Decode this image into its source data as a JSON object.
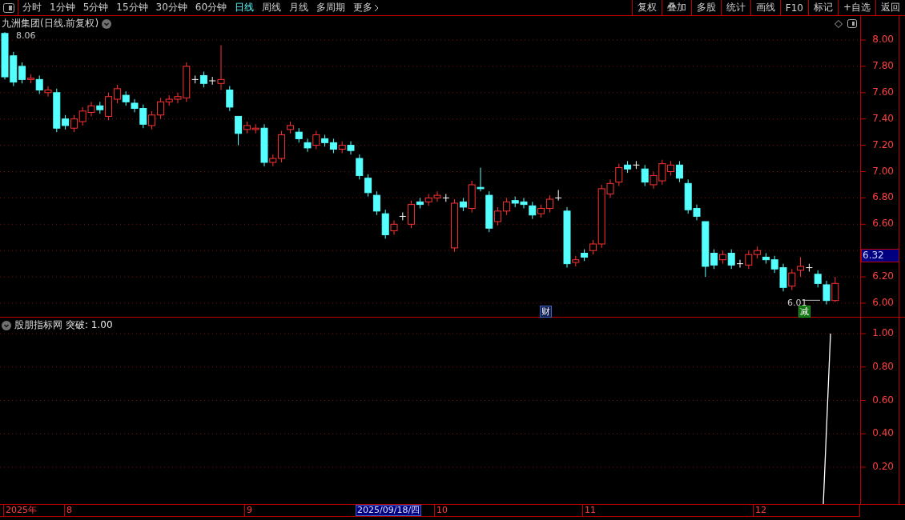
{
  "toolbar": {
    "periods": [
      {
        "label": "分时",
        "selected": false
      },
      {
        "label": "1分钟",
        "selected": false
      },
      {
        "label": "5分钟",
        "selected": false
      },
      {
        "label": "15分钟",
        "selected": false
      },
      {
        "label": "30分钟",
        "selected": false
      },
      {
        "label": "60分钟",
        "selected": false
      },
      {
        "label": "日线",
        "selected": true
      },
      {
        "label": "周线",
        "selected": false
      },
      {
        "label": "月线",
        "selected": false
      },
      {
        "label": "多周期",
        "selected": false
      }
    ],
    "more": "更多",
    "buttons": [
      "复权",
      "叠加",
      "多股",
      "统计",
      "画线",
      "F10",
      "标记",
      "+自选",
      "返回"
    ]
  },
  "main_chart": {
    "title": "九洲集团(日线.前复权)",
    "high_label": "8.06",
    "low_label": "6.01",
    "yticks": [
      "8.00",
      "7.80",
      "7.60",
      "7.40",
      "7.20",
      "7.00",
      "6.80",
      "6.60",
      "6.20",
      "6.00"
    ],
    "current_price": "6.32",
    "markers": [
      {
        "text": "财",
        "kind": "finance"
      },
      {
        "text": "减",
        "kind": "reduce"
      }
    ]
  },
  "indicator": {
    "name": "股朋指标网",
    "reading": "突破: 1.00",
    "yticks": [
      "1.00",
      "0.80",
      "0.60",
      "0.40",
      "0.20"
    ]
  },
  "time_axis": {
    "labels": [
      "2025年",
      "8",
      "9",
      "10",
      "11",
      "12"
    ],
    "cursor_date": "2025/09/18/四"
  }
}
